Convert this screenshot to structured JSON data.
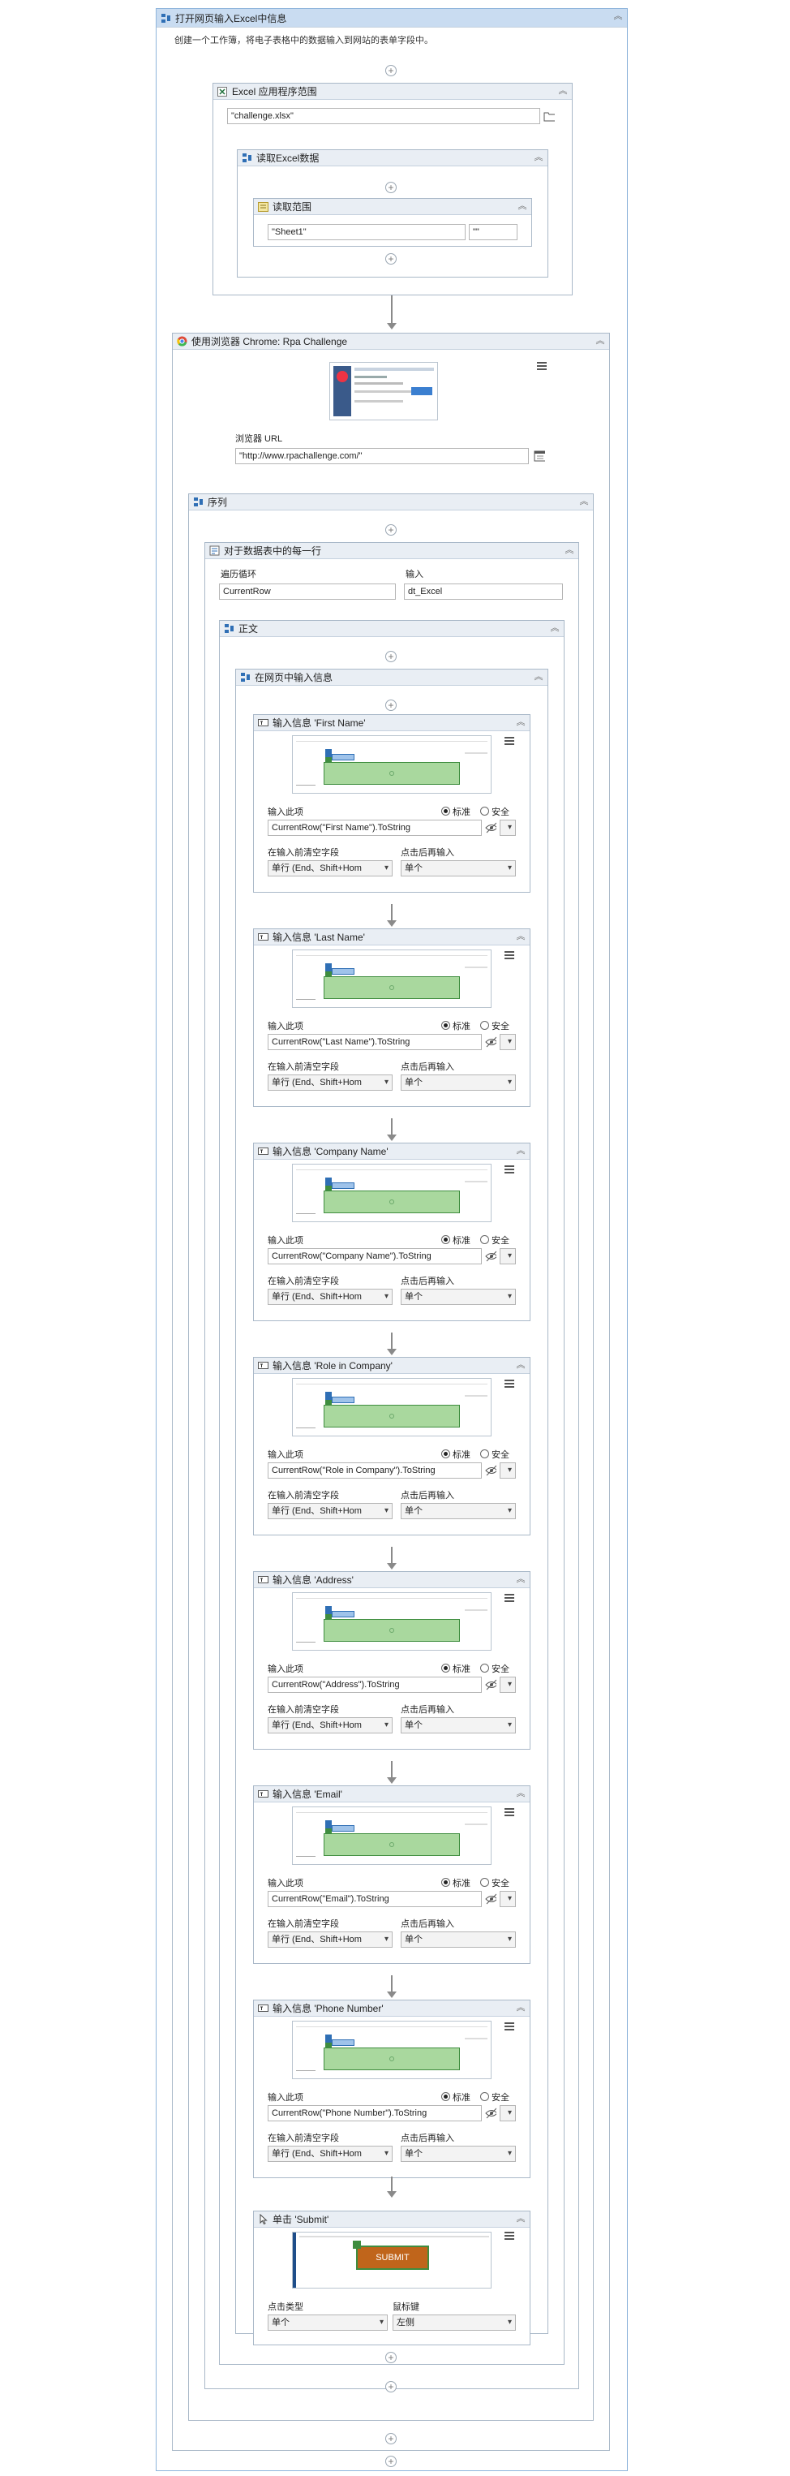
{
  "main": {
    "title": "打开网页输入Excel中信息",
    "annotation": "创建一个工作簿，将电子表格中的数据输入到网站的表单字段中。"
  },
  "excel_scope": {
    "title": "Excel 应用程序范围",
    "path": "\"challenge.xlsx\"",
    "read_sequence_title": "读取Excel数据",
    "read_range_title": "读取范围",
    "sheet": "\"Sheet1\"",
    "range": "\"\""
  },
  "browser": {
    "title": "使用浏览器 Chrome: Rpa Challenge",
    "url_label": "浏览器 URL",
    "url": "\"http://www.rpachallenge.com/\""
  },
  "sequence": {
    "title": "序列"
  },
  "foreach": {
    "title": "对于数据表中的每一行",
    "iterate_label": "遍历循环",
    "iterate_value": "CurrentRow",
    "input_label": "输入",
    "input_value": "dt_Excel"
  },
  "body": {
    "title": "正文"
  },
  "web_seq": {
    "title": "在网页中输入信息"
  },
  "common": {
    "type_this_label": "输入此项",
    "standard": "标准",
    "secure": "安全",
    "empty_label": "在输入前清空字段",
    "empty_value": "单行 (End、Shift+Hom",
    "click_label": "点击后再输入",
    "click_value": "单个"
  },
  "type_into": [
    {
      "title": "输入信息 'First Name'",
      "expr": "CurrentRow(\"First Name\").ToString"
    },
    {
      "title": "输入信息 'Last Name'",
      "expr": "CurrentRow(\"Last Name\").ToString"
    },
    {
      "title": "输入信息 'Company Name'",
      "expr": "CurrentRow(\"Company Name\").ToString"
    },
    {
      "title": "输入信息 'Role in Company'",
      "expr": "CurrentRow(\"Role in Company\").ToString"
    },
    {
      "title": "输入信息 'Address'",
      "expr": "CurrentRow(\"Address\").ToString"
    },
    {
      "title": "输入信息 'Email'",
      "expr": "CurrentRow(\"Email\").ToString"
    },
    {
      "title": "输入信息 'Phone Number'",
      "expr": "CurrentRow(\"Phone Number\").ToString"
    }
  ],
  "click": {
    "title": "单击 'Submit'",
    "submit_text": "SUBMIT",
    "click_type_label": "点击类型",
    "click_type_value": "单个",
    "mouse_label": "鼠标键",
    "mouse_value": "左侧"
  },
  "colors": {
    "header_main": "#c9dcf1",
    "green_box": "#a9d89e",
    "submit": "#c0651b"
  },
  "icons": [
    "sequence-icon",
    "excel-icon",
    "chrome-icon",
    "type-into-icon",
    "click-icon",
    "collapse-icon",
    "hamburger-menu-icon",
    "folder-icon",
    "plus-icon"
  ]
}
